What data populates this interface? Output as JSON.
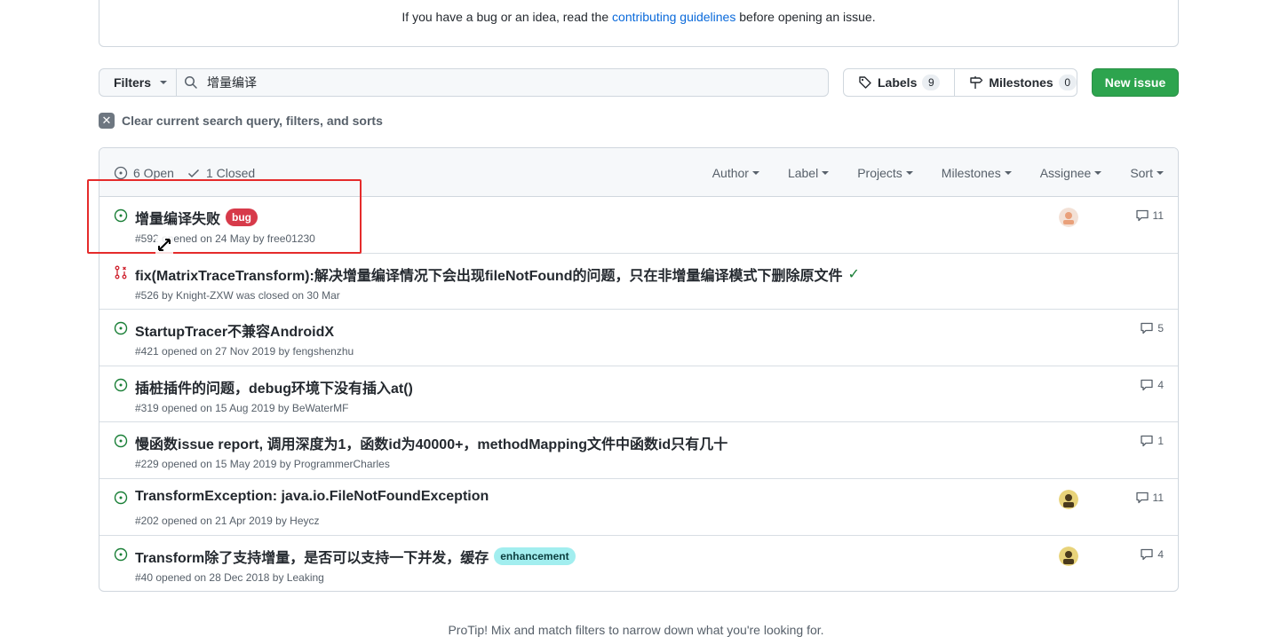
{
  "notice": {
    "prefix": "If you have a bug or an idea, read the",
    "link": "contributing guidelines",
    "suffix": "before opening an issue."
  },
  "toolbar": {
    "filters_label": "Filters",
    "search_value": "增量编译",
    "labels_label": "Labels",
    "labels_count": "9",
    "milestones_label": "Milestones",
    "milestones_count": "0",
    "new_issue_label": "New issue"
  },
  "clear_text": "Clear current search query, filters, and sorts",
  "header": {
    "open_label": "6 Open",
    "closed_label": "1 Closed",
    "filters": [
      "Author",
      "Label",
      "Projects",
      "Milestones",
      "Assignee",
      "Sort"
    ]
  },
  "issues": [
    {
      "title": "增量编译失败",
      "label": "bug",
      "meta": "#592 opened on 24 May by free01230",
      "comments": "11",
      "state": "open",
      "avatar": "pink"
    },
    {
      "title": "fix(MatrixTraceTransform):解决增量编译情况下会出现fileNotFound的问题，只在非增量编译模式下删除原文件",
      "label": "",
      "meta": "#526 by Knight-ZXW was closed on 30 Mar",
      "comments": "",
      "state": "pr-closed",
      "avatar": ""
    },
    {
      "title": "StartupTracer不兼容AndroidX",
      "label": "",
      "meta": "#421 opened on 27 Nov 2019 by fengshenzhu",
      "comments": "5",
      "state": "open",
      "avatar": ""
    },
    {
      "title": "插桩插件的问题，debug环境下没有插入at()",
      "label": "",
      "meta": "#319 opened on 15 Aug 2019 by BeWaterMF",
      "comments": "4",
      "state": "open",
      "avatar": ""
    },
    {
      "title": "慢函数issue report, 调用深度为1，函数id为40000+，methodMapping文件中函数id只有几十",
      "label": "",
      "meta": "#229 opened on 15 May 2019 by ProgrammerCharles",
      "comments": "1",
      "state": "open",
      "avatar": ""
    },
    {
      "title": "TransformException: java.io.FileNotFoundException",
      "label": "",
      "meta": "#202 opened on 21 Apr 2019 by Heycz",
      "comments": "11",
      "state": "open",
      "avatar": "yellow"
    },
    {
      "title": "Transform除了支持增量，是否可以支持一下并发，缓存",
      "label": "enhancement",
      "meta": "#40 opened on 28 Dec 2018 by Leaking",
      "comments": "4",
      "state": "open",
      "avatar": "yellow"
    }
  ],
  "protip": "ProTip! Mix and match filters to narrow down what you're looking for.",
  "colors": {
    "bug": "#d73a4a",
    "enhancement": "#a2eeef",
    "open_icon": "#1a7f37",
    "closed_pr_icon": "#cf222e",
    "new_issue_bg": "#2da44e"
  }
}
